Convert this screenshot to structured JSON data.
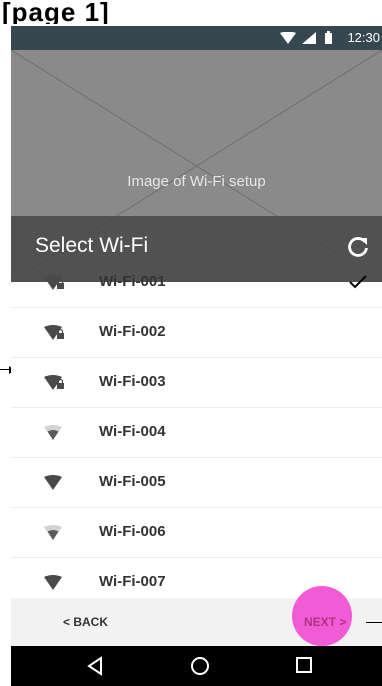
{
  "header": {
    "label": "[page 1]"
  },
  "status_bar": {
    "time": "12:30"
  },
  "hero": {
    "caption": "Image of Wi-Fi setup"
  },
  "title_bar": {
    "title": "Select Wi-Fi",
    "refresh_icon": "refresh-icon"
  },
  "networks": [
    {
      "name": "Wi-Fi-001",
      "secured": true,
      "signal": "full",
      "selected": true
    },
    {
      "name": "Wi-Fi-002",
      "secured": true,
      "signal": "full",
      "selected": false
    },
    {
      "name": "Wi-Fi-003",
      "secured": true,
      "signal": "full",
      "selected": false
    },
    {
      "name": "Wi-Fi-004",
      "secured": false,
      "signal": "medium",
      "selected": false
    },
    {
      "name": "Wi-Fi-005",
      "secured": false,
      "signal": "full",
      "selected": false
    },
    {
      "name": "Wi-Fi-006",
      "secured": false,
      "signal": "medium",
      "selected": false
    },
    {
      "name": "Wi-Fi-007",
      "secured": false,
      "signal": "full",
      "selected": false
    }
  ],
  "footer": {
    "back_label": "< BACK",
    "next_label": "NEXT >"
  },
  "colors": {
    "status_bar": "#37474f",
    "next_highlight": "#f25bd6",
    "next_text": "#b0337f"
  }
}
